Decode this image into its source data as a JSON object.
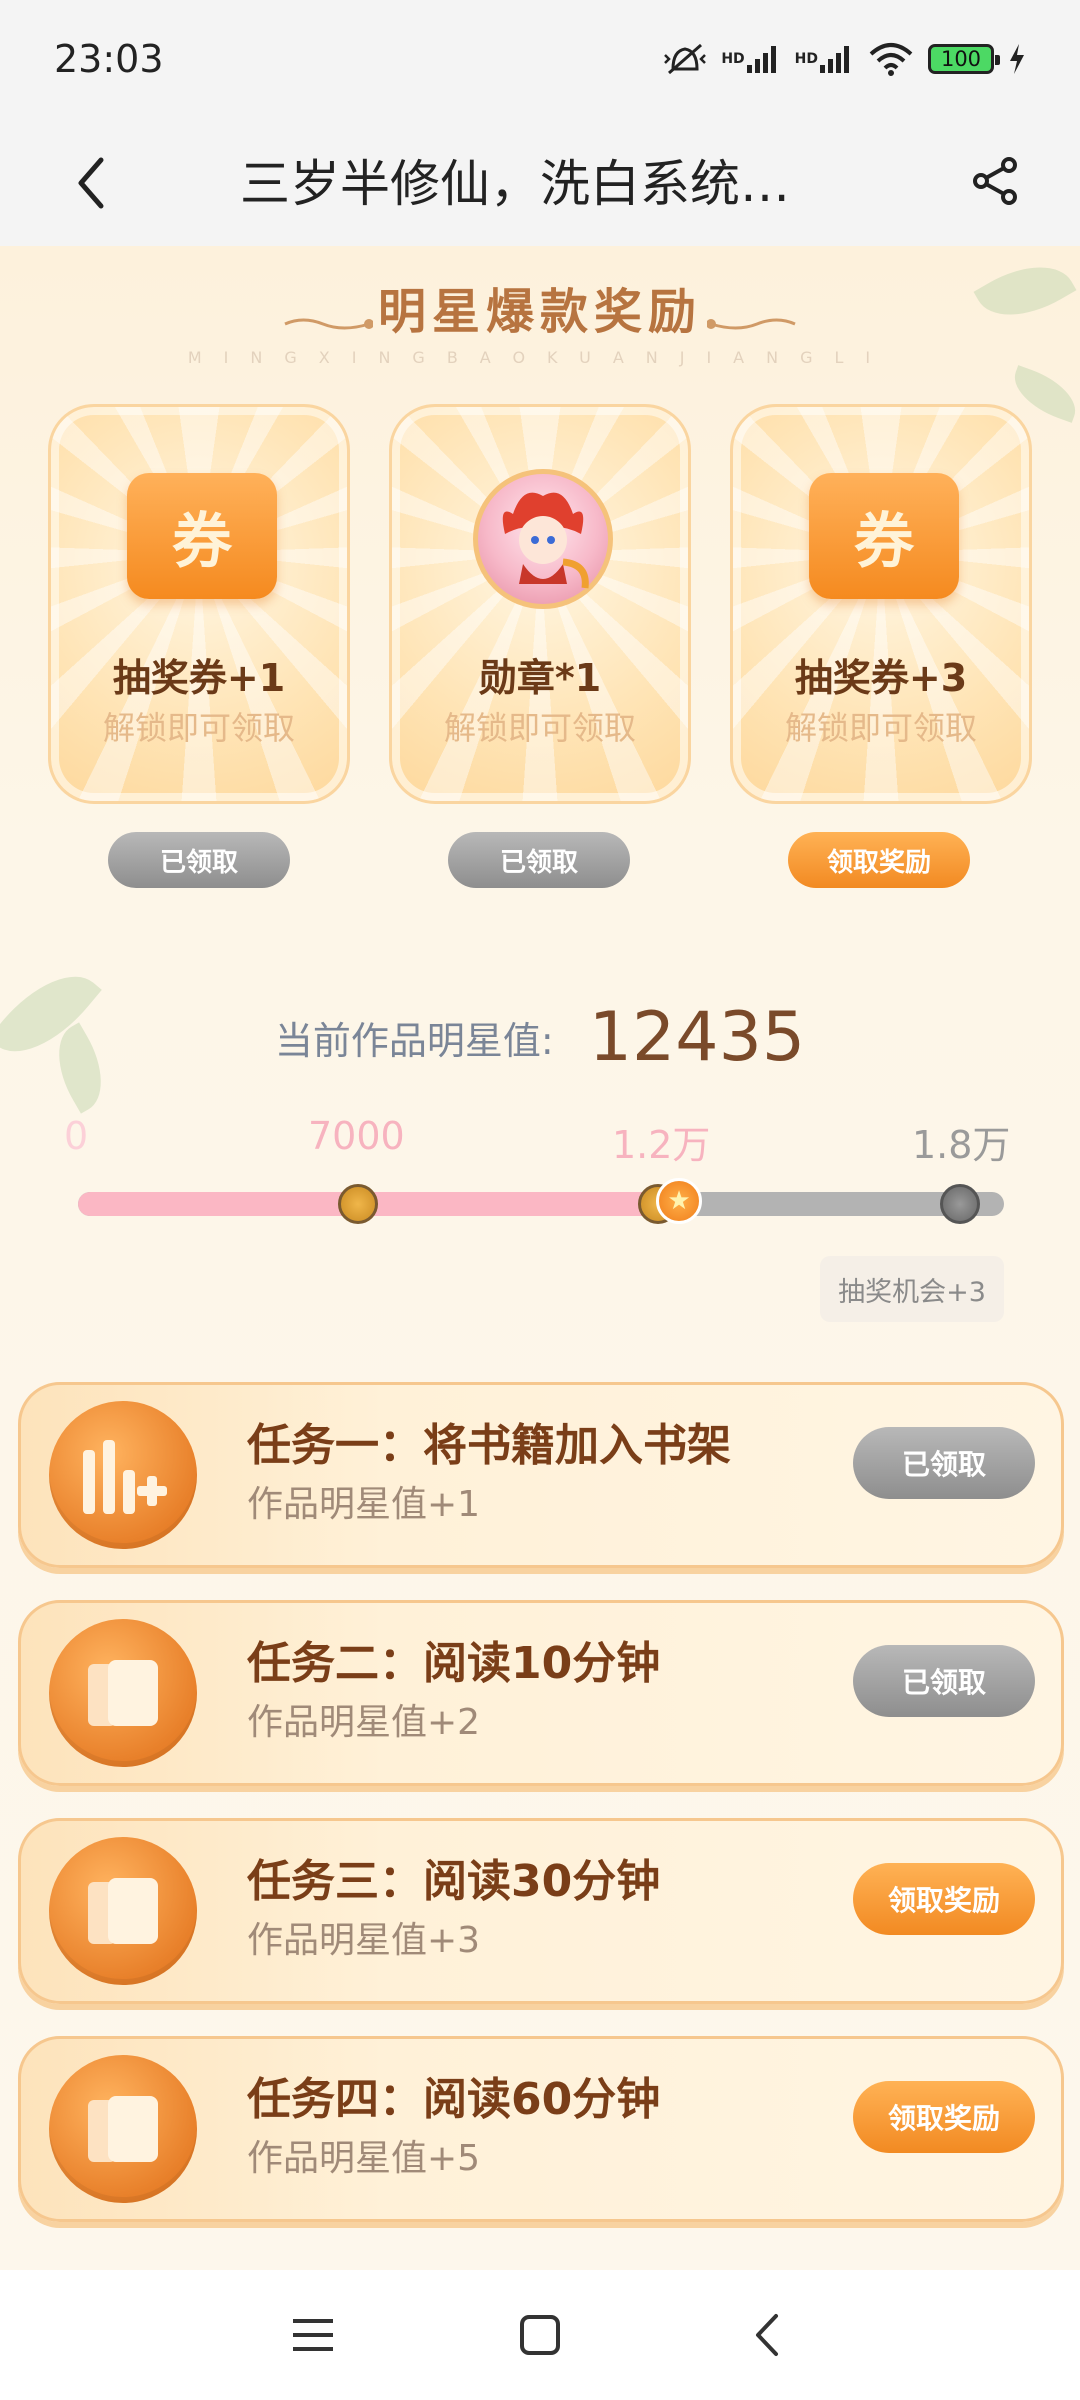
{
  "status_bar": {
    "time": "23:03",
    "battery": "100",
    "signal_badge_1": "HD",
    "signal_badge_2": "HD"
  },
  "title_bar": {
    "title": "三岁半修仙，洗白系统…"
  },
  "section": {
    "heading": "明星爆款奖励",
    "heading_pinyin": "MINGXINGBAOKUANJIANGLI"
  },
  "rewards": [
    {
      "icon": "ticket-icon",
      "icon_text": "券",
      "title": "抽奖券+1",
      "subtitle": "解锁即可领取",
      "button": "已领取",
      "state": "claimed"
    },
    {
      "icon": "medal-icon",
      "title": "勋章*1",
      "subtitle": "解锁即可领取",
      "button": "已领取",
      "state": "claimed"
    },
    {
      "icon": "ticket-icon",
      "icon_text": "券",
      "title": "抽奖券+3",
      "subtitle": "解锁即可领取",
      "button": "领取奖励",
      "state": "claimable"
    }
  ],
  "progress": {
    "label": "当前作品明星值:",
    "value": "12435",
    "ticks": [
      "0",
      "7000",
      "1.2万",
      "1.8万"
    ],
    "fill_fraction": 0.665,
    "tooltip": "抽奖机会+3"
  },
  "tasks": [
    {
      "icon": "add-bookshelf-icon",
      "title": "任务一：将书籍加入书架",
      "reward": "作品明星值+1",
      "button": "已领取",
      "state": "claimed"
    },
    {
      "icon": "book-icon",
      "title": "任务二：阅读10分钟",
      "reward": "作品明星值+2",
      "button": "已领取",
      "state": "claimed"
    },
    {
      "icon": "book-icon",
      "title": "任务三：阅读30分钟",
      "reward": "作品明星值+3",
      "button": "领取奖励",
      "state": "claimable"
    },
    {
      "icon": "book-icon",
      "title": "任务四：阅读60分钟",
      "reward": "作品明星值+5",
      "button": "领取奖励",
      "state": "claimable"
    }
  ],
  "colors": {
    "accent_orange": "#f28a22",
    "claimed_gray": "#9a9a9a",
    "progress_pink": "#fbb7c4",
    "background": "#fdf5e6"
  }
}
